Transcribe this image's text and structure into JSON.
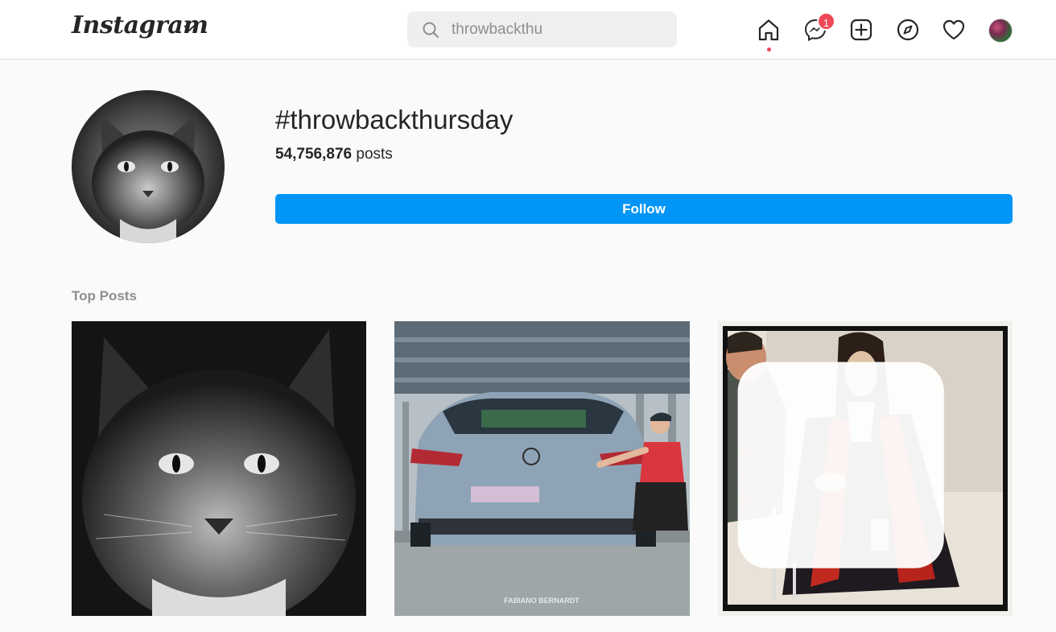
{
  "nav": {
    "logo": "Instagram",
    "search_value": "throwbackthu",
    "messenger_badge": "1",
    "icons": [
      "home-icon",
      "messenger-icon",
      "new-post-icon",
      "explore-icon",
      "activity-heart-icon",
      "profile-avatar"
    ]
  },
  "header": {
    "hashtag": "#throwbackthursday",
    "post_count": "54,756,876",
    "posts_label": "posts",
    "follow_label": "Follow"
  },
  "section": {
    "top_posts_label": "Top Posts"
  },
  "posts": [
    {
      "subject": "black-and-white cat portrait"
    },
    {
      "subject": "grey Opel car in parking garage",
      "watermark": "FABIANO BERNARDT"
    },
    {
      "subject": "vintage photo with date stamp"
    }
  ],
  "colors": {
    "accent": "#0095f6",
    "badge": "#ed4956",
    "background": "#fafafa"
  }
}
